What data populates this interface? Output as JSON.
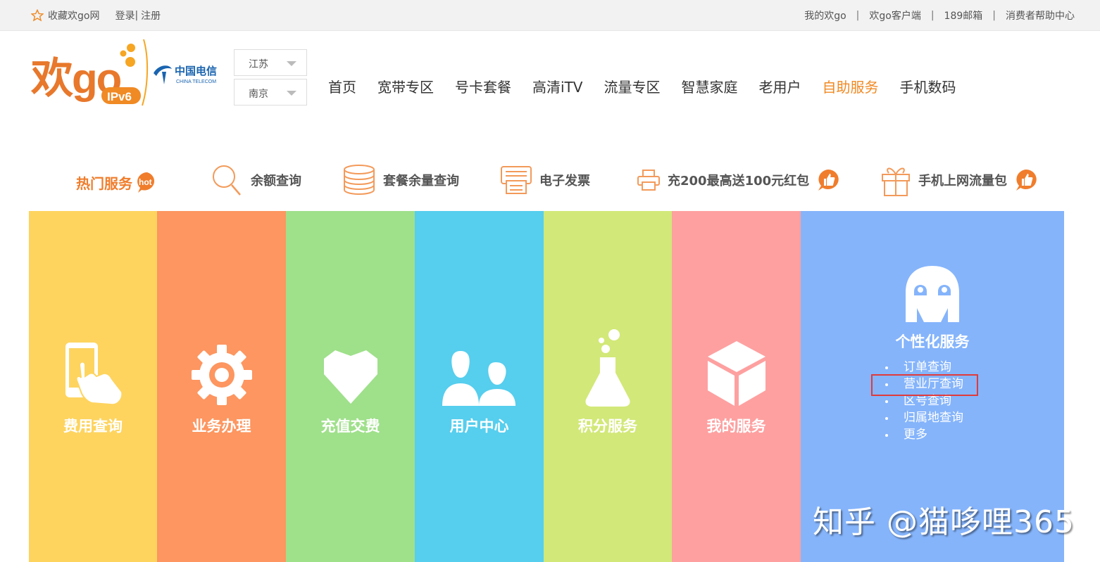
{
  "topbar": {
    "favorite_label": "收藏欢go网",
    "login_label": "登录",
    "divider": "|",
    "register_label": "注册",
    "right_links": [
      "我的欢go",
      "欢go客户端",
      "189邮箱",
      "消费者帮助中心"
    ]
  },
  "logo": {
    "brand_text": "欢go",
    "badge_text": "IPv6",
    "telecom_cn": "中国电信",
    "telecom_en": "CHINA TELECOM"
  },
  "region": {
    "province": "江苏",
    "city": "南京"
  },
  "nav": {
    "items": [
      "首页",
      "宽带专区",
      "号卡套餐",
      "高清iTV",
      "流量专区",
      "智慧家庭",
      "老用户",
      "自助服务",
      "手机数码"
    ],
    "active": "自助服务"
  },
  "hot": {
    "title": "热门服务",
    "badge": "hot",
    "items": [
      "余额查询",
      "套餐余量查询",
      "电子发票",
      "充200最高送100元红包",
      "手机上网流量包"
    ]
  },
  "tiles": [
    "费用查询",
    "业务办理",
    "充值交费",
    "用户中心",
    "积分服务",
    "我的服务"
  ],
  "personal": {
    "title": "个性化服务",
    "links": [
      "订单查询",
      "营业厅查询",
      "区号查询",
      "归属地查询",
      "更多"
    ]
  },
  "colors": {
    "accent": "#f08a24",
    "tile_colors": [
      "#fed45f",
      "#fd9660",
      "#9fe08b",
      "#56ceee",
      "#d2e878",
      "#fea0a0",
      "#85b4fb"
    ],
    "highlight": "#e03a3a"
  },
  "watermark": "知乎 @猫哆哩365"
}
